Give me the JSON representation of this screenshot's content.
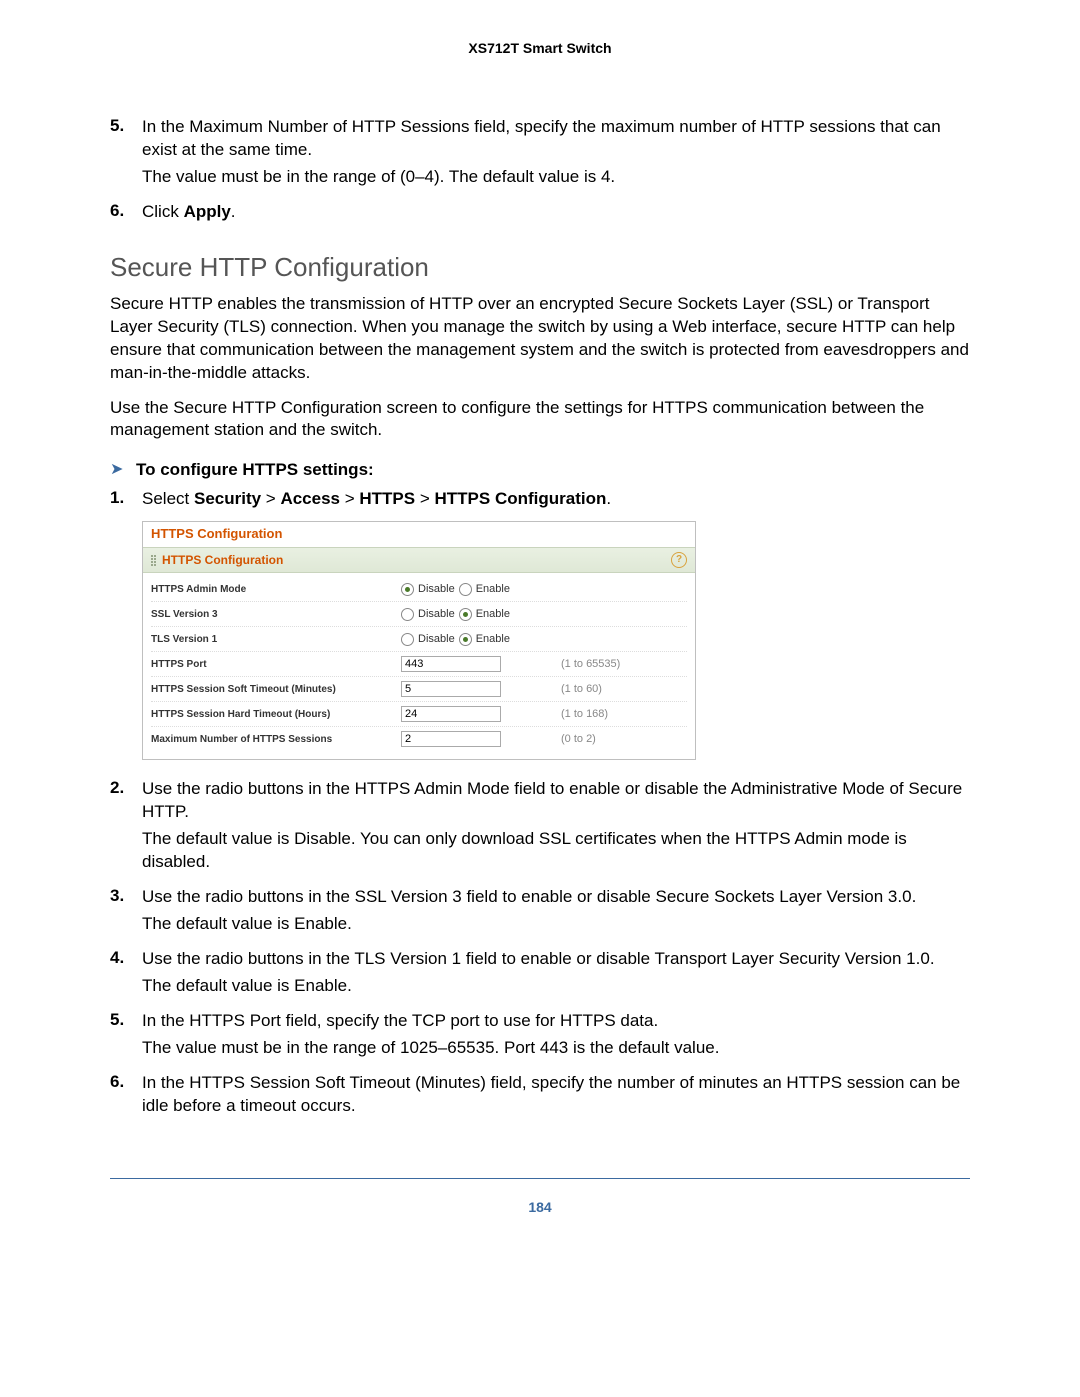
{
  "header": "XS712T Smart Switch",
  "page_number": "184",
  "pre_steps": {
    "step5": {
      "num": "5.",
      "text": "In the Maximum Number of HTTP Sessions field, specify the maximum number of HTTP sessions that can exist at the same time.",
      "note": "The value must be in the range of (0–4). The default value is 4."
    },
    "step6": {
      "num": "6.",
      "prefix": "Click ",
      "bold": "Apply",
      "suffix": "."
    }
  },
  "section_title": "Secure HTTP Configuration",
  "intro_p1": "Secure HTTP enables the transmission of HTTP over an encrypted Secure Sockets Layer (SSL) or Transport Layer Security (TLS) connection. When you manage the switch by using a Web interface, secure HTTP can help ensure that communication between the management system and the switch is protected from eavesdroppers and man-in-the-middle attacks.",
  "intro_p2": "Use the Secure HTTP Configuration screen to configure the settings for HTTPS communication between the management station and the switch.",
  "task_title": "To configure HTTPS settings:",
  "step1": {
    "num": "1.",
    "prefix": "Select ",
    "b1": "Security",
    "sep1": " > ",
    "b2": "Access",
    "sep2": " > ",
    "b3": "HTTPS",
    "sep3": " > ",
    "b4": "HTTPS Configuration",
    "suffix": "."
  },
  "shot": {
    "outer_title": "HTTPS Configuration",
    "bar_title": "HTTPS Configuration",
    "rows": [
      {
        "label": "HTTPS Admin Mode",
        "kind": "radio",
        "sel": "disable",
        "opt_disable": "Disable",
        "opt_enable": "Enable",
        "hint": ""
      },
      {
        "label": "SSL Version 3",
        "kind": "radio",
        "sel": "enable",
        "opt_disable": "Disable",
        "opt_enable": "Enable",
        "hint": ""
      },
      {
        "label": "TLS Version 1",
        "kind": "radio",
        "sel": "enable",
        "opt_disable": "Disable",
        "opt_enable": "Enable",
        "hint": ""
      },
      {
        "label": "HTTPS Port",
        "kind": "text",
        "value": "443",
        "hint": "(1 to 65535)"
      },
      {
        "label": "HTTPS Session Soft Timeout (Minutes)",
        "kind": "text",
        "value": "5",
        "hint": "(1 to 60)"
      },
      {
        "label": "HTTPS Session Hard Timeout (Hours)",
        "kind": "text",
        "value": "24",
        "hint": "(1 to 168)"
      },
      {
        "label": "Maximum Number of HTTPS Sessions",
        "kind": "text",
        "value": "2",
        "hint": "(0 to 2)"
      }
    ]
  },
  "step2": {
    "num": "2.",
    "text": "Use the radio buttons in the HTTPS Admin Mode field to enable or disable the Administrative Mode of Secure HTTP.",
    "note": "The default value is Disable. You can only download SSL certificates when the HTTPS Admin mode is disabled."
  },
  "step3": {
    "num": "3.",
    "text": "Use the radio buttons in the SSL Version 3 field to enable or disable Secure Sockets Layer Version 3.0.",
    "note": "The default value is Enable."
  },
  "step4": {
    "num": "4.",
    "text": "Use the radio buttons in the TLS Version 1 field to enable or disable Transport Layer Security Version 1.0.",
    "note": "The default value is Enable."
  },
  "step5b": {
    "num": "5.",
    "text": "In the HTTPS Port field, specify the TCP port to use for HTTPS data.",
    "note": "The value must be in the range of 1025–65535. Port 443 is the default value."
  },
  "step6b": {
    "num": "6.",
    "text": "In the HTTPS Session Soft Timeout (Minutes) field, specify the number of minutes an HTTPS session can be idle before a timeout occurs."
  }
}
